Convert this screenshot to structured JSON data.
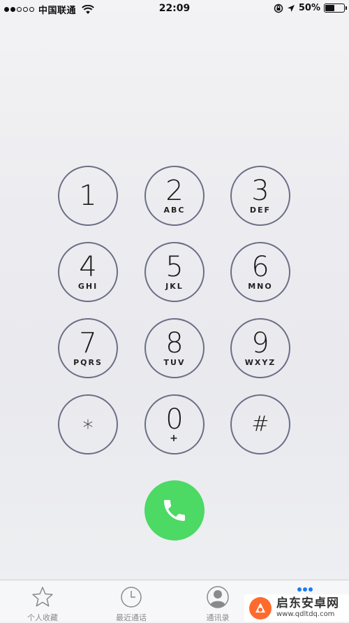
{
  "status_bar": {
    "carrier": "中国联通",
    "time": "22:09",
    "battery_percent": "50%",
    "battery_level": 0.5,
    "signal_bars_filled": 2,
    "signal_bars_total": 5
  },
  "keypad": {
    "keys": [
      {
        "digit": "1",
        "letters": ""
      },
      {
        "digit": "2",
        "letters": "ABC"
      },
      {
        "digit": "3",
        "letters": "DEF"
      },
      {
        "digit": "4",
        "letters": "GHI"
      },
      {
        "digit": "5",
        "letters": "JKL"
      },
      {
        "digit": "6",
        "letters": "MNO"
      },
      {
        "digit": "7",
        "letters": "PQRS"
      },
      {
        "digit": "8",
        "letters": "TUV"
      },
      {
        "digit": "9",
        "letters": "WXYZ"
      },
      {
        "digit": "∗",
        "letters": ""
      },
      {
        "digit": "0",
        "letters": "+"
      },
      {
        "digit": "#",
        "letters": ""
      }
    ]
  },
  "call_button": {
    "icon": "phone-icon",
    "color": "#4cd964"
  },
  "tab_bar": {
    "tabs": [
      {
        "label": "个人收藏",
        "icon": "star-icon"
      },
      {
        "label": "最近通话",
        "icon": "clock-icon"
      },
      {
        "label": "通讯录",
        "icon": "contacts-icon"
      },
      {
        "label": "",
        "icon": "keypad-icon"
      }
    ]
  },
  "watermark": {
    "title": "启东安卓网",
    "url": "www.qdltdq.com"
  }
}
